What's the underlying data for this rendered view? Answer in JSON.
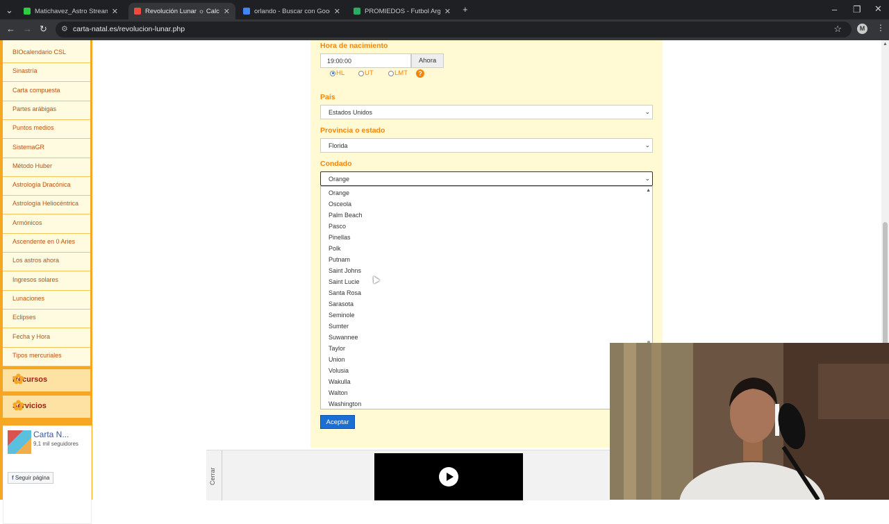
{
  "browser": {
    "tabs": [
      {
        "title": "Matichavez_Astro Stream - Wa",
        "favicon_color": "#2ecc40"
      },
      {
        "title": "Revolución Lunar ☼ Calcula tu lu",
        "favicon_color": "#e74c3c",
        "active": true
      },
      {
        "title": "orlando - Buscar con Google",
        "favicon_color": "#4285f4"
      },
      {
        "title": "PROMIEDOS - Futbol Argentino",
        "favicon_color": "#27ae60"
      }
    ],
    "url": "carta-natal.es/revolucion-lunar.php",
    "profile_initial": "M"
  },
  "sidebar": {
    "items": [
      "BIOcalendario CSL",
      "Sinastría",
      "Carta compuesta",
      "Partes arábigas",
      "Puntos medios",
      "SistemaGR",
      "Método Huber",
      "Astrología Dracónica",
      "Astrología Heliocéntrica",
      "Armónicos",
      "Ascendente en 0 Aries",
      "Los astros ahora",
      "Ingresos solares",
      "Lunaciones",
      "Eclipses",
      "Fecha y Hora",
      "Tipos mercuriales"
    ],
    "sections": [
      "Recursos",
      "Servicios"
    ],
    "facebook": {
      "name": "Carta N...",
      "followers": "9,1 mil seguidores",
      "button": "Seguir página"
    }
  },
  "form": {
    "birth_time_label": "Hora de nacimiento",
    "birth_time_value": "19:00:00",
    "now_button": "Ahora",
    "time_modes": [
      {
        "label": "HL",
        "checked": true
      },
      {
        "label": "UT",
        "checked": false
      },
      {
        "label": "LMT",
        "checked": false
      }
    ],
    "help": "?",
    "country_label": "País",
    "country_value": "Estados Unidos",
    "state_label": "Provincia o estado",
    "state_value": "Florida",
    "county_label": "Condado",
    "county_value": "Orange",
    "county_options": [
      "Orange",
      "Osceola",
      "Palm Beach",
      "Pasco",
      "Pinellas",
      "Polk",
      "Putnam",
      "Saint Johns",
      "Saint Lucie",
      "Santa Rosa",
      "Sarasota",
      "Seminole",
      "Sumter",
      "Suwannee",
      "Taylor",
      "Union",
      "Volusia",
      "Wakulla",
      "Walton",
      "Washington"
    ],
    "submit": "Aceptar"
  },
  "ad": {
    "close_label": "Cerrar"
  },
  "icons": {
    "chevron": "⌄",
    "back": "←",
    "forward": "→",
    "reload": "↻",
    "star": "☆"
  }
}
